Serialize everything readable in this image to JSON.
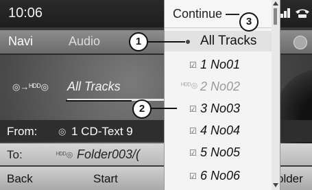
{
  "status": {
    "time": "10:06"
  },
  "menu": {
    "items": [
      "Navi",
      "Audio"
    ]
  },
  "main": {
    "track_title": "All Tracks",
    "source_icon": "cd-to-hdd-icon"
  },
  "copy": {
    "from_label": "From:",
    "from_value": "1 CD-Text 9",
    "to_label": "To:",
    "to_value": "Folder003/("
  },
  "bottom": {
    "back": "Back",
    "start": "Start",
    "folder": "older"
  },
  "dropdown": {
    "continue_label": "Continue",
    "all_tracks": "All Tracks",
    "tracks": [
      {
        "label": "1 No01",
        "checked": true,
        "available": true
      },
      {
        "label": "2 No02",
        "checked": false,
        "available": false
      },
      {
        "label": "3 No03",
        "checked": true,
        "available": true
      },
      {
        "label": "4 No04",
        "checked": true,
        "available": true
      },
      {
        "label": "5 No05",
        "checked": true,
        "available": true
      },
      {
        "label": "6 No06",
        "checked": true,
        "available": true
      }
    ]
  },
  "callouts": [
    "1",
    "2",
    "3"
  ]
}
